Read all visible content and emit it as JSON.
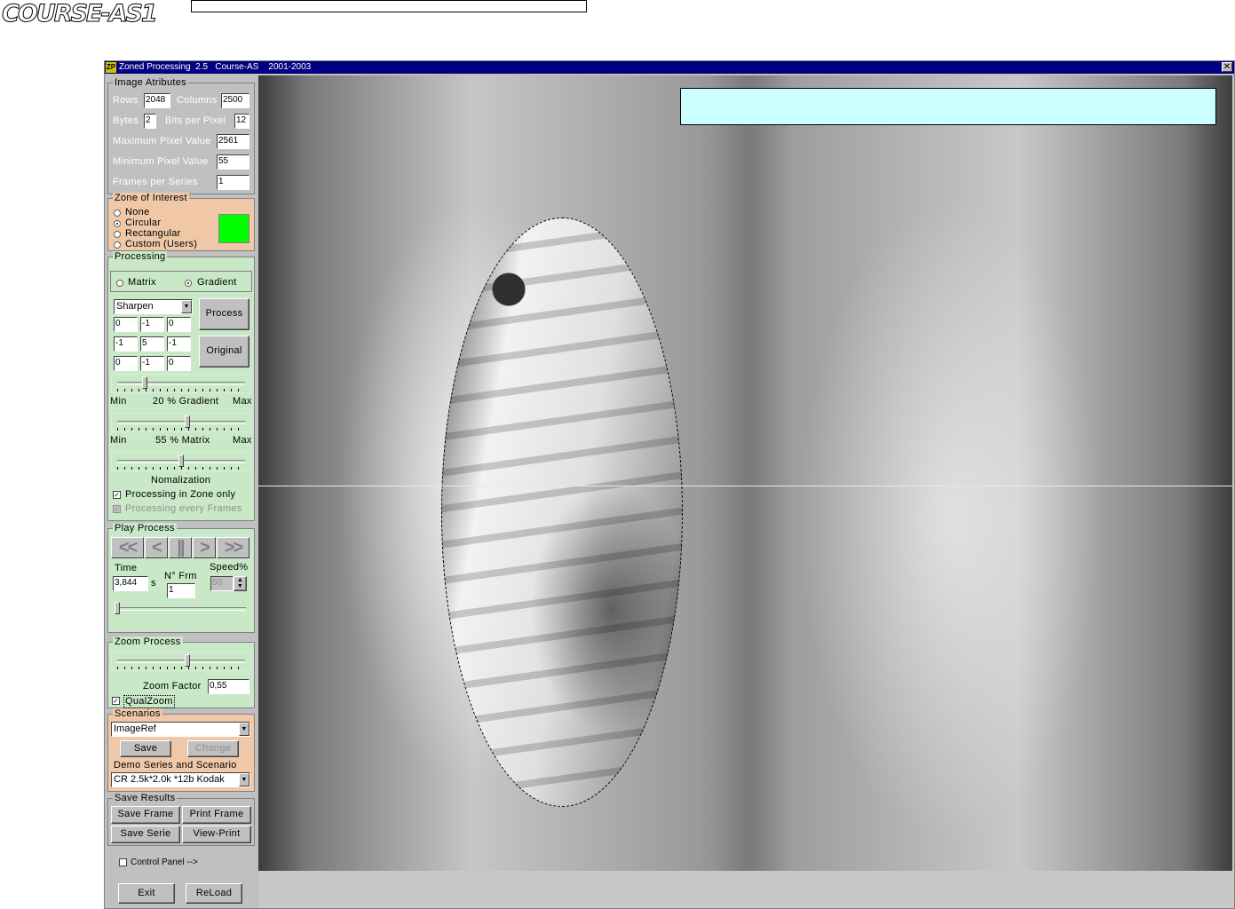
{
  "logo": {
    "text": "COURSE-AS1"
  },
  "window": {
    "title": "Zoned Processing  2.5   Course-AS    2001-2003",
    "app_icon": "ZP",
    "close_glyph": "✕"
  },
  "image_attributes": {
    "title": "Image  Atributes",
    "rows_label": "Rows",
    "rows_value": "2048",
    "columns_label": "Columns",
    "columns_value": "2500",
    "bytes_label": "Bytes",
    "bytes_value": "2",
    "bits_label": "Bits per Pixel",
    "bits_value": "12",
    "max_label": "Maximum Pixel Value",
    "max_value": "2561",
    "min_label": "Minimum Pixel Value",
    "min_value": "55",
    "frames_label": "Frames per Series",
    "frames_value": "1"
  },
  "zone_of_interest": {
    "title": "Zone of Interest",
    "options": [
      "None",
      "Circular",
      "Rectangular",
      "Custom (Users)"
    ],
    "selected": "Circular",
    "color": "#00ff00"
  },
  "processing": {
    "title": "Processing",
    "mode_matrix": "Matrix",
    "mode_gradient": "Gradient",
    "mode_selected": "Gradient",
    "filter": "Sharpen",
    "matrix": [
      "0",
      "-1",
      "0",
      "-1",
      "5",
      "-1",
      "0",
      "-1",
      "0"
    ],
    "process_label": "Process",
    "original_label": "Original",
    "gradient_min": "Min",
    "gradient_text": "20 % Gradient",
    "gradient_max": "Max",
    "gradient_pct": 20,
    "matrix_min": "Min",
    "matrix_text": "55 % Matrix",
    "matrix_max": "Max",
    "matrix_pct": 55,
    "normalization_label": "Nomalization",
    "normalization_pct": 50,
    "zone_only_label": "Processing in Zone only",
    "every_frames_label": "Processing every Frames"
  },
  "play": {
    "title": "Play  Process",
    "buttons": [
      "<<",
      "<",
      "||",
      ">",
      ">>"
    ],
    "time_label": "Time",
    "time_value": "3,844",
    "time_unit": "s",
    "frame_label": "N° Frm",
    "frame_value": "1",
    "speed_label": "Speed%",
    "speed_value": "50",
    "position_pct": 0
  },
  "zoom": {
    "title": "Zoom  Process",
    "factor_label": "Zoom Factor",
    "factor_value": "0,55",
    "quality_label": "QualZoom",
    "slider_pct": 55
  },
  "scenarios": {
    "title": "Scenarios",
    "selected": "ImageRef",
    "save_label": "Save",
    "change_label": "Change",
    "demo_label": "Demo Series and Scenario",
    "demo_selected": "CR 2.5k*2.0k *12b Kodak"
  },
  "save_results": {
    "title": "Save  Results",
    "save_frame": "Save Frame",
    "print_frame": "Print Frame",
    "save_serie": "Save Serie",
    "view_print": "View-Print"
  },
  "control_panel_label": "Control Panel -->",
  "exit_label": "Exit",
  "reload_label": "ReLoad",
  "colors": {
    "title_bar": "#000080",
    "info_box": "#ccffff",
    "zone_peach": "#f0c8a8",
    "processing_green": "#c8e8c8"
  }
}
